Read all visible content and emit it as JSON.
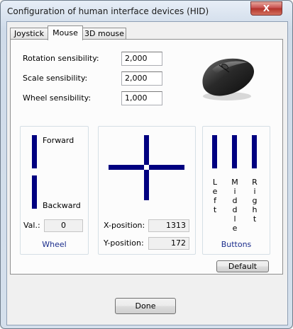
{
  "window": {
    "title": "Configuration of human interface devices (HID)",
    "close_glyph": "X"
  },
  "tabs": [
    {
      "label": "Joystick",
      "active": false
    },
    {
      "label": "Mouse",
      "active": true
    },
    {
      "label": "3D mouse",
      "active": false
    }
  ],
  "settings": {
    "rotation": {
      "label": "Rotation sensibility:",
      "value": "2,000"
    },
    "scale": {
      "label": "Scale sensibility:",
      "value": "2,000"
    },
    "wheel": {
      "label": "Wheel sensibility:",
      "value": "1,000"
    }
  },
  "mouse_image": {
    "icon": "mouse-icon"
  },
  "wheel_group": {
    "forward": "Forward",
    "backward": "Backward",
    "val_label": "Val.:",
    "val": "0",
    "caption": "Wheel"
  },
  "position_group": {
    "x_label": "X-position:",
    "x_value": "1313",
    "y_label": "Y-position:",
    "y_value": "172"
  },
  "buttons_group": {
    "left": [
      "L",
      "e",
      "f",
      "t"
    ],
    "middle": [
      "M",
      "i",
      "d",
      "d",
      "l",
      "e"
    ],
    "right": [
      "R",
      "i",
      "g",
      "h",
      "t"
    ],
    "caption": "Buttons"
  },
  "actions": {
    "default": "Default",
    "done": "Done"
  },
  "colors": {
    "indicator": "#000080",
    "caption": "#1a2c8c"
  }
}
